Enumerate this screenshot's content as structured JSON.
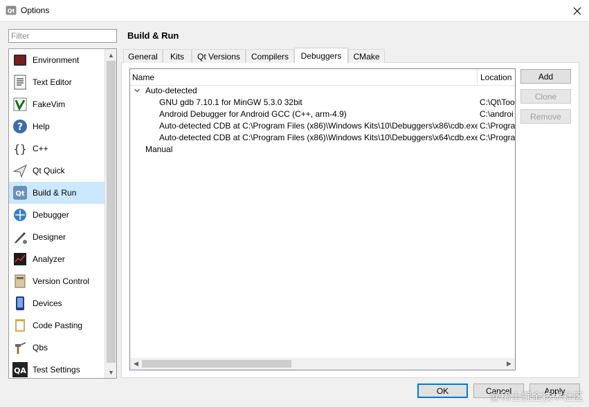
{
  "window": {
    "title": "Options"
  },
  "filter": {
    "placeholder": "Filter",
    "value": ""
  },
  "categories": [
    {
      "label": "Environment",
      "icon": "environment-icon"
    },
    {
      "label": "Text Editor",
      "icon": "text-editor-icon"
    },
    {
      "label": "FakeVim",
      "icon": "fakevim-icon"
    },
    {
      "label": "Help",
      "icon": "help-icon"
    },
    {
      "label": "C++",
      "icon": "cpp-icon"
    },
    {
      "label": "Qt Quick",
      "icon": "qt-quick-icon"
    },
    {
      "label": "Build & Run",
      "icon": "build-run-icon",
      "selected": true
    },
    {
      "label": "Debugger",
      "icon": "debugger-icon"
    },
    {
      "label": "Designer",
      "icon": "designer-icon"
    },
    {
      "label": "Analyzer",
      "icon": "analyzer-icon"
    },
    {
      "label": "Version Control",
      "icon": "version-control-icon"
    },
    {
      "label": "Devices",
      "icon": "devices-icon"
    },
    {
      "label": "Code Pasting",
      "icon": "code-pasting-icon"
    },
    {
      "label": "Qbs",
      "icon": "qbs-icon"
    },
    {
      "label": "Test Settings",
      "icon": "test-settings-icon",
      "icon_text": "QA"
    }
  ],
  "page": {
    "title": "Build & Run",
    "tabs": [
      {
        "label": "General"
      },
      {
        "label": "Kits"
      },
      {
        "label": "Qt Versions"
      },
      {
        "label": "Compilers"
      },
      {
        "label": "Debuggers",
        "active": true
      },
      {
        "label": "CMake"
      }
    ]
  },
  "debuggers": {
    "columns": [
      "Name",
      "Location"
    ],
    "groups": [
      {
        "label": "Auto-detected",
        "expanded": true,
        "items": [
          {
            "name": "GNU gdb 7.10.1 for MinGW 5.3.0 32bit",
            "location": "C:\\Qt\\Too"
          },
          {
            "name": "Android Debugger for Android GCC (C++, arm-4.9)",
            "location": "C:\\androi"
          },
          {
            "name": "Auto-detected CDB at C:\\Program Files (x86)\\Windows Kits\\10\\Debuggers\\x86\\cdb.exe",
            "location": "C:\\Progra"
          },
          {
            "name": "Auto-detected CDB at C:\\Program Files (x86)\\Windows Kits\\10\\Debuggers\\x64\\cdb.exe",
            "location": "C:\\Progra"
          }
        ]
      },
      {
        "label": "Manual",
        "expanded": false,
        "items": []
      }
    ],
    "buttons": {
      "add": "Add",
      "clone": "Clone",
      "remove": "Remove"
    }
  },
  "footer": {
    "ok": "OK",
    "cancel": "Cancel",
    "apply": "Apply"
  },
  "watermark": "@稀土掘金技术社区",
  "colors": {
    "selection": "#cce8ff",
    "default_button_border": "#0078d7",
    "disabled_text": "#a0a0a0"
  }
}
